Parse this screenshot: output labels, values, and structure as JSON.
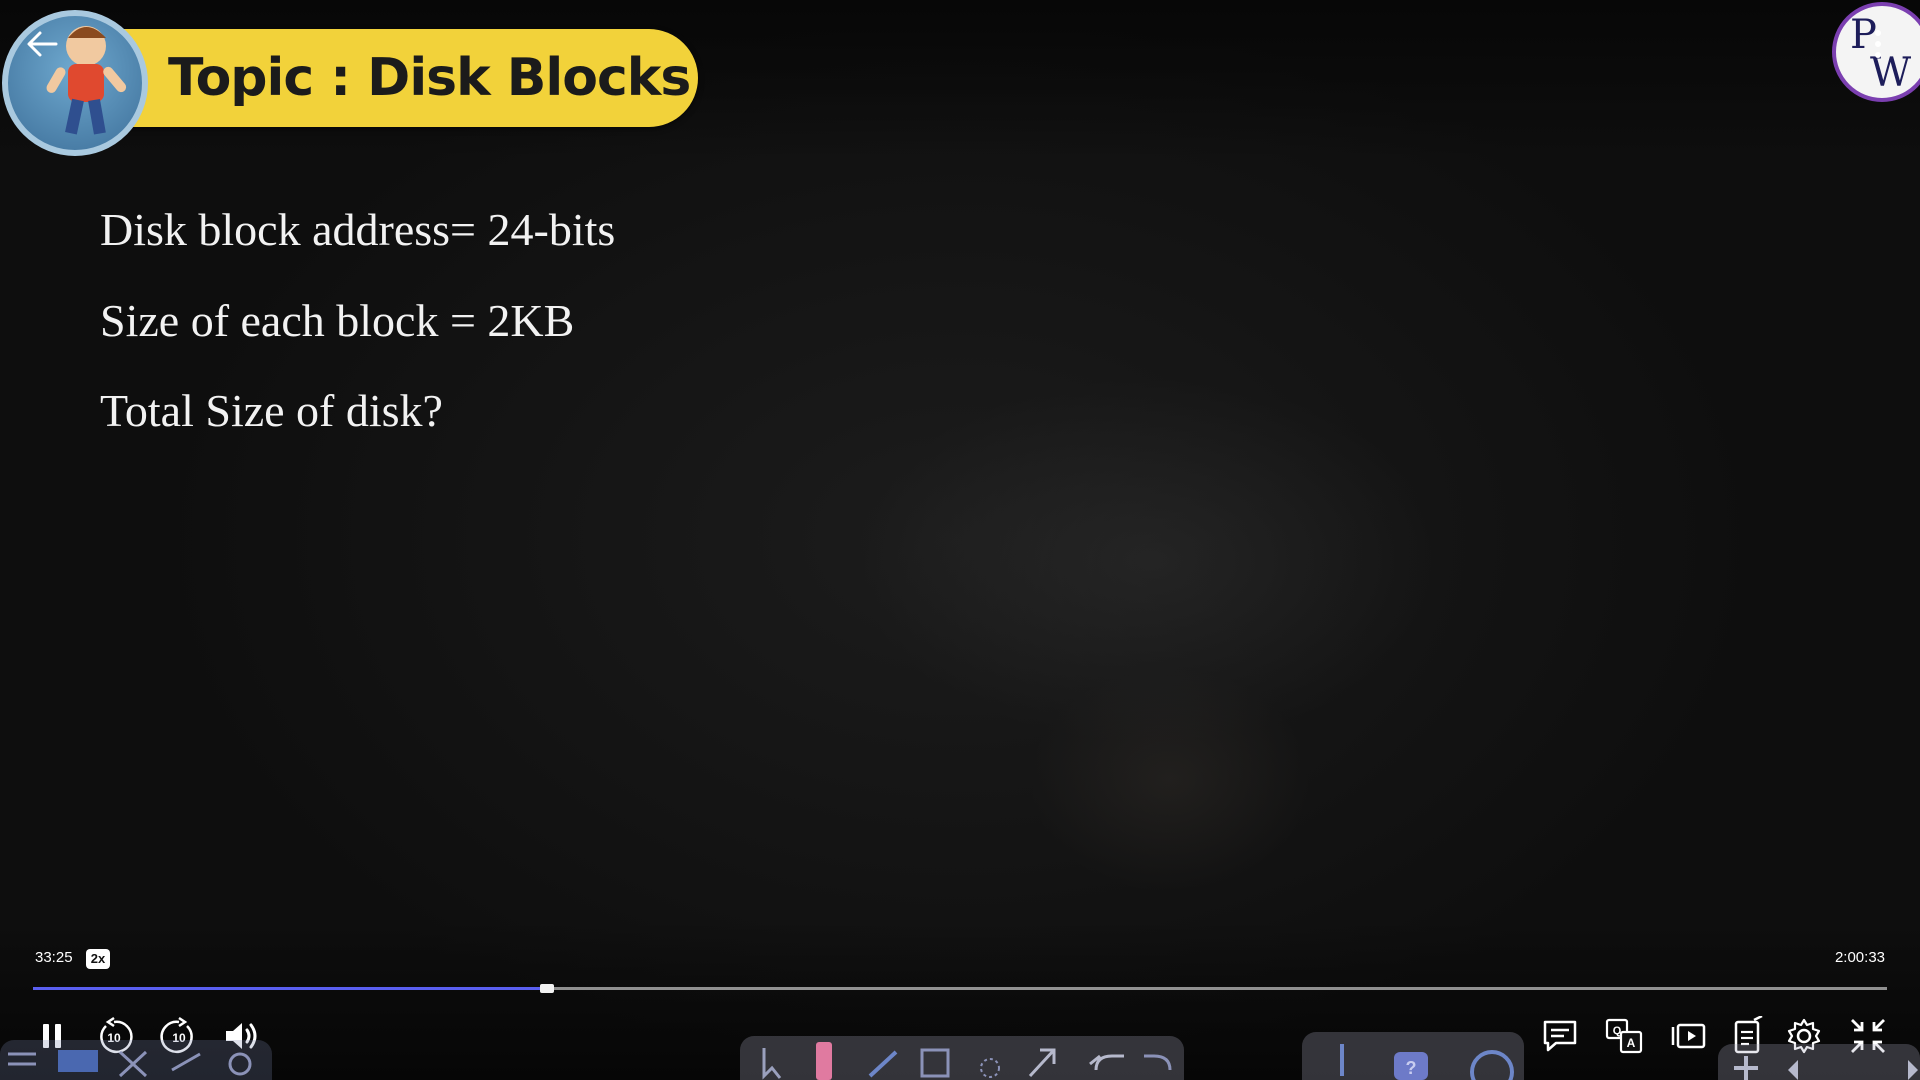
{
  "slide": {
    "topic": "Topic : Disk Blocks",
    "lines": [
      "Disk block address= 24-bits",
      "Size of each block = 2KB",
      "Total Size of disk?"
    ]
  },
  "brand": {
    "logo_text": "PW"
  },
  "player": {
    "current_time": "33:25",
    "total_time": "2:00:33",
    "speed": "2x",
    "progress_fraction": 0.277,
    "accent_color": "#5a5ff0",
    "skip_back_seconds": "10",
    "skip_forward_seconds": "10"
  },
  "icons": {
    "back": "arrow-left-icon",
    "more": "more-vertical-icon",
    "pause": "pause-icon",
    "rewind": "rewind-10-icon",
    "forward": "forward-10-icon",
    "volume": "volume-icon",
    "comments": "comments-icon",
    "translate": "translate-icon",
    "playlist": "playlist-icon",
    "notes": "notes-icon",
    "settings": "gear-icon",
    "exit_fullscreen": "exit-fullscreen-icon"
  }
}
